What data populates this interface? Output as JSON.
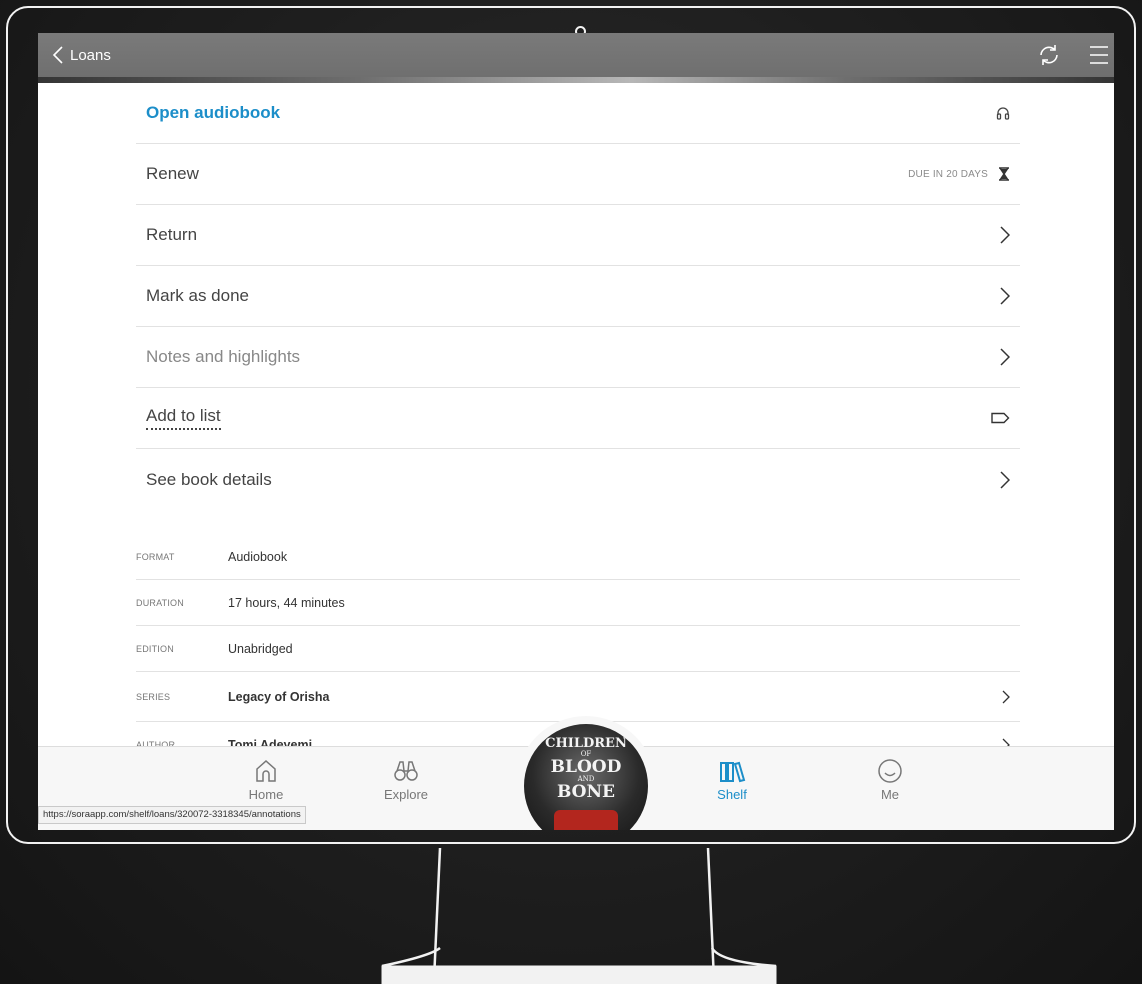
{
  "header": {
    "back_label": "Loans",
    "sync_icon": "sync-icon",
    "menu_icon": "menu-icon"
  },
  "actions": [
    {
      "label": "Open audiobook",
      "icon": "headphones-icon"
    },
    {
      "label": "Renew",
      "right_text": "DUE IN 20 DAYS",
      "icon": "hourglass-icon"
    },
    {
      "label": "Return",
      "icon": "chevron-right-icon"
    },
    {
      "label": "Mark as done",
      "icon": "chevron-right-icon"
    },
    {
      "label": "Notes and highlights",
      "icon": "chevron-right-icon"
    },
    {
      "label": "Add to list",
      "icon": "tag-icon"
    },
    {
      "label": "See book details",
      "icon": "chevron-right-icon"
    }
  ],
  "details": [
    {
      "key": "FORMAT",
      "value": "Audiobook"
    },
    {
      "key": "DURATION",
      "value": "17 hours, 44 minutes"
    },
    {
      "key": "EDITION",
      "value": "Unabridged"
    },
    {
      "key": "SERIES",
      "value": "Legacy of Orisha"
    },
    {
      "key": "AUTHOR",
      "value": "Tomi Adeyemi"
    }
  ],
  "bottom_nav": {
    "home": "Home",
    "explore": "Explore",
    "shelf": "Shelf",
    "me": "Me"
  },
  "cover": {
    "line1": "CHILDREN",
    "line2": "OF",
    "line3": "BLOOD",
    "line4": "AND",
    "line5": "BONE"
  },
  "status_url": "https://soraapp.com/shelf/loans/320072-3318345/annotations",
  "colors": {
    "accent": "#1c8ec9",
    "topbar": "#737373",
    "background": "#1e1e1e"
  }
}
